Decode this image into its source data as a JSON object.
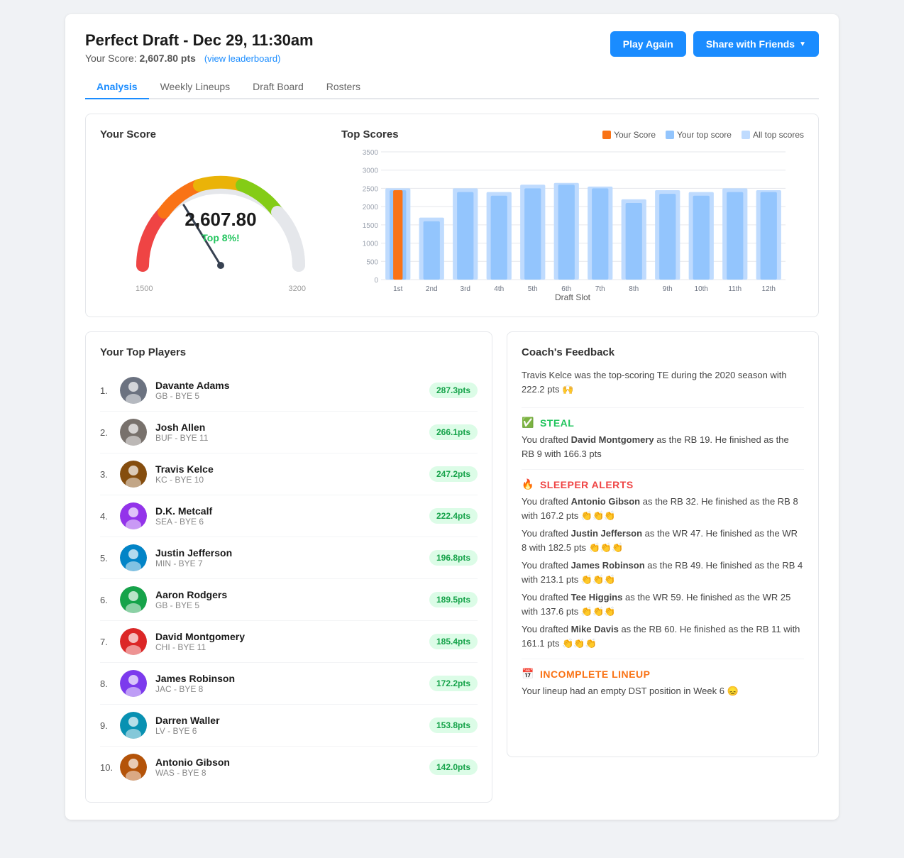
{
  "header": {
    "title": "Perfect Draft - Dec 29, 11:30am",
    "score_label": "Your Score:",
    "score_value": "2,607.80 pts",
    "leaderboard_link": "(view leaderboard)",
    "play_again": "Play Again",
    "share": "Share with Friends"
  },
  "tabs": [
    {
      "label": "Analysis",
      "active": true
    },
    {
      "label": "Weekly Lineups"
    },
    {
      "label": "Draft Board"
    },
    {
      "label": "Rosters"
    }
  ],
  "gauge": {
    "section_title": "Your Score",
    "score": "2,607.80",
    "percentile": "Top 8%!",
    "min": "1500",
    "max": "3200"
  },
  "top_scores": {
    "title": "Top Scores",
    "legend": [
      {
        "label": "Your Score",
        "color": "#f97316"
      },
      {
        "label": "Your top score",
        "color": "#93c5fd"
      },
      {
        "label": "All top scores",
        "color": "#bfdbfe"
      }
    ],
    "x_axis_title": "Draft Slot",
    "slots": [
      "1st",
      "2nd",
      "3rd",
      "4th",
      "5th",
      "6th",
      "7th",
      "8th",
      "9th",
      "10th",
      "11th",
      "12th"
    ],
    "your_scores": [
      2450,
      0,
      0,
      0,
      0,
      0,
      0,
      0,
      0,
      0,
      0,
      0
    ],
    "top_scores": [
      2450,
      1600,
      2400,
      2300,
      2500,
      2600,
      2500,
      2100,
      2350,
      2300,
      2400,
      2400
    ],
    "all_top_scores": [
      2500,
      1700,
      2500,
      2400,
      2600,
      2650,
      2550,
      2200,
      2450,
      2400,
      2500,
      2450
    ],
    "y_max": 3500,
    "y_labels": [
      "3500",
      "3000",
      "2500",
      "2000",
      "1500",
      "1000",
      "500",
      "0"
    ]
  },
  "players": {
    "title": "Your Top Players",
    "list": [
      {
        "rank": "1.",
        "name": "Davante Adams",
        "team": "GB - BYE 5",
        "score": "287.3pts"
      },
      {
        "rank": "2.",
        "name": "Josh Allen",
        "team": "BUF - BYE 11",
        "score": "266.1pts"
      },
      {
        "rank": "3.",
        "name": "Travis Kelce",
        "team": "KC - BYE 10",
        "score": "247.2pts"
      },
      {
        "rank": "4.",
        "name": "D.K. Metcalf",
        "team": "SEA - BYE 6",
        "score": "222.4pts"
      },
      {
        "rank": "5.",
        "name": "Justin Jefferson",
        "team": "MIN - BYE 7",
        "score": "196.8pts"
      },
      {
        "rank": "6.",
        "name": "Aaron Rodgers",
        "team": "GB - BYE 5",
        "score": "189.5pts"
      },
      {
        "rank": "7.",
        "name": "David Montgomery",
        "team": "CHI - BYE 11",
        "score": "185.4pts"
      },
      {
        "rank": "8.",
        "name": "James Robinson",
        "team": "JAC - BYE 8",
        "score": "172.2pts"
      },
      {
        "rank": "9.",
        "name": "Darren Waller",
        "team": "LV - BYE 6",
        "score": "153.8pts"
      },
      {
        "rank": "10.",
        "name": "Antonio Gibson",
        "team": "WAS - BYE 8",
        "score": "142.0pts"
      }
    ]
  },
  "feedback": {
    "title": "Coach's Feedback",
    "intro": "Travis Kelce was the top-scoring TE during the 2020 season with 222.2 pts 🙌",
    "sections": [
      {
        "type": "steal",
        "icon": "✅",
        "label": "STEAL",
        "text": "You drafted David Montgomery as the RB 19. He finished as the RB 9 with 166.3 pts"
      },
      {
        "type": "sleeper",
        "icon": "🔥",
        "label": "SLEEPER ALERTS",
        "items": [
          "You drafted Antonio Gibson as the RB 32. He finished as the RB 8 with 167.2 pts 👏👏👏",
          "You drafted Justin Jefferson as the WR 47. He finished as the WR 8 with 182.5 pts 👏👏👏",
          "You drafted James Robinson as the RB 49. He finished as the RB 4 with 213.1 pts 👏👏👏",
          "You drafted Tee Higgins as the WR 59. He finished as the WR 25 with 137.6 pts 👏👏👏",
          "You drafted Mike Davis as the RB 60. He finished as the RB 11 with 161.1 pts 👏👏👏"
        ]
      },
      {
        "type": "incomplete",
        "icon": "📅",
        "label": "INCOMPLETE LINEUP",
        "text": "Your lineup had an empty DST position in Week 6 😞"
      }
    ]
  }
}
